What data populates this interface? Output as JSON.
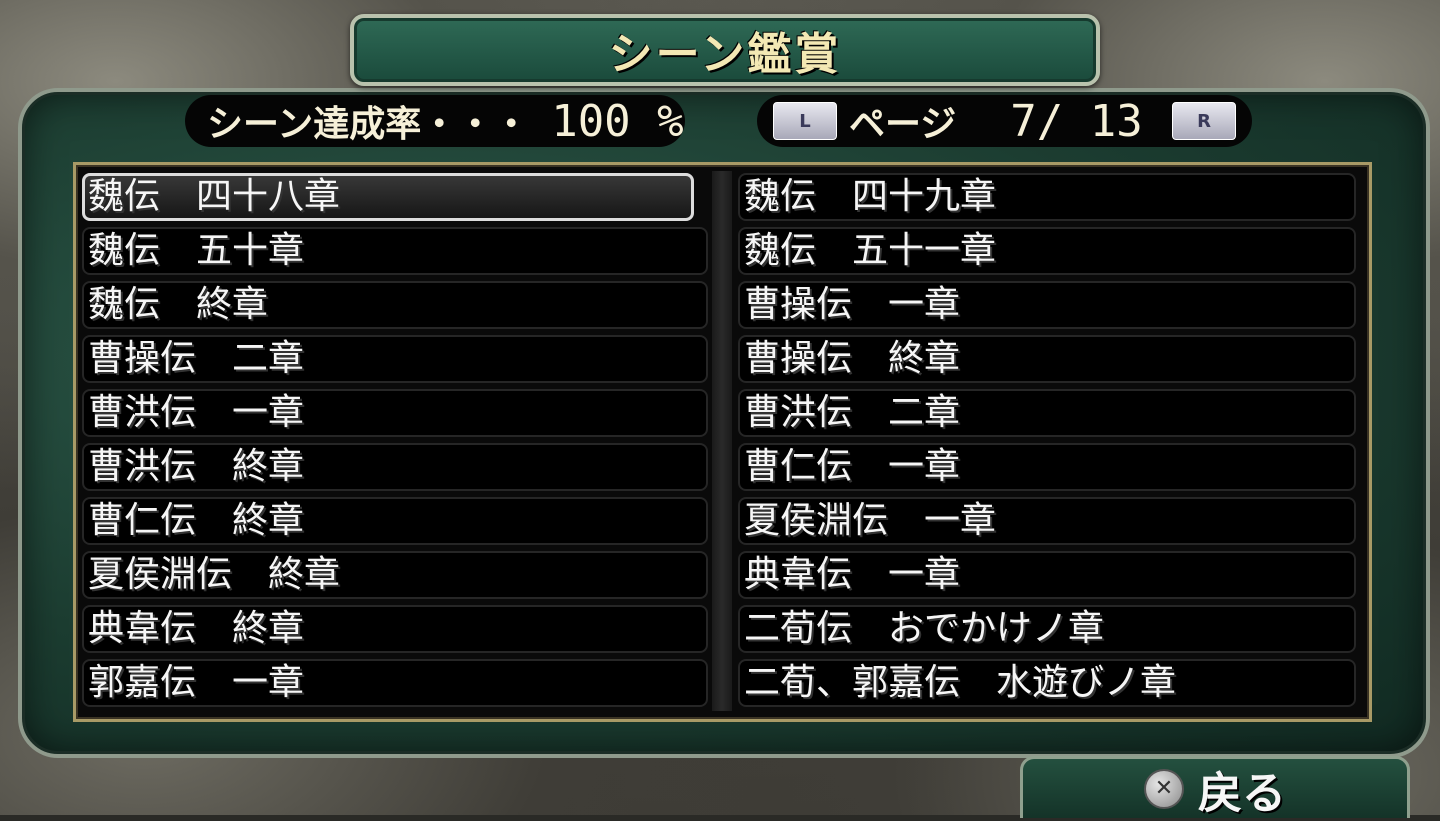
{
  "header": {
    "title": "シーン鑑賞"
  },
  "status": {
    "rate_label": "シーン達成率・・・",
    "rate_value": "100 %",
    "l_button": "L",
    "page_label": "ページ",
    "page_value": "7/ 13",
    "r_button": "R"
  },
  "scenes": {
    "left": [
      "魏伝　四十八章",
      "魏伝　五十章",
      "魏伝　終章",
      "曹操伝　二章",
      "曹洪伝　一章",
      "曹洪伝　終章",
      "曹仁伝　終章",
      "夏侯淵伝　終章",
      "典韋伝　終章",
      "郭嘉伝　一章"
    ],
    "right": [
      "魏伝　四十九章",
      "魏伝　五十一章",
      "曹操伝　一章",
      "曹操伝　終章",
      "曹洪伝　二章",
      "曹仁伝　一章",
      "夏侯淵伝　一章",
      "典韋伝　一章",
      "二荀伝　おでかけノ章",
      "二荀、郭嘉伝　水遊びノ章"
    ],
    "selected": "left.0"
  },
  "footer": {
    "back_label": "戻る",
    "back_icon": "cross-button-icon"
  }
}
